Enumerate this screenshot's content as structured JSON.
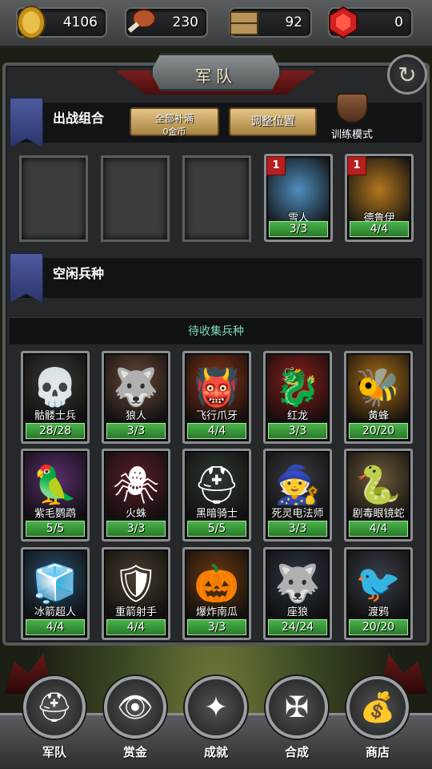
{
  "resources": {
    "gold": "4106",
    "meat": "230",
    "wood": "92",
    "gems": "0"
  },
  "header": {
    "title": "军队"
  },
  "battle_group": {
    "title": "出战组合",
    "fill_all_line1": "全部补满",
    "fill_all_line2": "0金币",
    "adjust_label": "调整位置",
    "training_label": "训练模式"
  },
  "deployed_units": [
    {
      "name": "雪人",
      "count": "3/3",
      "badge": "1",
      "icon": "yeti-icon",
      "color": "#4f8fbf"
    },
    {
      "name": "德鲁伊",
      "count": "4/4",
      "badge": "1",
      "icon": "druid-icon",
      "color": "#b3771d"
    }
  ],
  "idle": {
    "title": "空闲兵种"
  },
  "collect": {
    "title": "待收集兵种"
  },
  "units": [
    {
      "name": "骷髅士兵",
      "count": "28/28",
      "icon": "skull-icon",
      "glyph": "💀",
      "color": "#3b3a36"
    },
    {
      "name": "狼人",
      "count": "3/3",
      "icon": "werewolf-icon",
      "glyph": "🐺",
      "color": "#6a4a3b"
    },
    {
      "name": "飞行爪牙",
      "count": "4/4",
      "icon": "imp-icon",
      "glyph": "👹",
      "color": "#8a3418"
    },
    {
      "name": "红龙",
      "count": "3/3",
      "icon": "dragon-icon",
      "glyph": "🐉",
      "color": "#8a1f1a"
    },
    {
      "name": "黄蜂",
      "count": "20/20",
      "icon": "wasp-icon",
      "glyph": "🐝",
      "color": "#a86d19"
    },
    {
      "name": "紫毛鹦鹉",
      "count": "5/5",
      "icon": "parrot-icon",
      "glyph": "🦜",
      "color": "#5a2f6b"
    },
    {
      "name": "火蛛",
      "count": "3/3",
      "icon": "spider-icon",
      "glyph": "🕷",
      "color": "#5a1f28"
    },
    {
      "name": "黑暗骑士",
      "count": "5/5",
      "icon": "knight-icon",
      "glyph": "⛑",
      "color": "#2f3a33"
    },
    {
      "name": "死灵电法师",
      "count": "3/3",
      "icon": "necromancer-icon",
      "glyph": "🧙",
      "color": "#3d3d44"
    },
    {
      "name": "剧毒眼镜蛇",
      "count": "4/4",
      "icon": "cobra-icon",
      "glyph": "🐍",
      "color": "#6e5a3a"
    },
    {
      "name": "冰箭超人",
      "count": "4/4",
      "icon": "ice-archer-icon",
      "glyph": "🧊",
      "color": "#2c4f6b"
    },
    {
      "name": "重箭射手",
      "count": "4/4",
      "icon": "heavy-archer-icon",
      "glyph": "🛡",
      "color": "#4a3f2e"
    },
    {
      "name": "爆炸南瓜",
      "count": "3/3",
      "icon": "pumpkin-icon",
      "glyph": "🎃",
      "color": "#6b3a12"
    },
    {
      "name": "座狼",
      "count": "24/24",
      "icon": "warg-icon",
      "glyph": "🐺",
      "color": "#2e3844"
    },
    {
      "name": "渡鸦",
      "count": "20/20",
      "icon": "raven-icon",
      "glyph": "🐦",
      "color": "#3a3f48"
    }
  ],
  "nav": [
    {
      "label": "军队",
      "icon": "helmet-icon",
      "glyph": "⛑"
    },
    {
      "label": "赏金",
      "icon": "eye-icon",
      "glyph": "👁"
    },
    {
      "label": "成就",
      "icon": "compass-star-icon",
      "glyph": "✦"
    },
    {
      "label": "合成",
      "icon": "knot-icon",
      "glyph": "✠"
    },
    {
      "label": "商店",
      "icon": "bag-icon",
      "glyph": "💰"
    }
  ]
}
